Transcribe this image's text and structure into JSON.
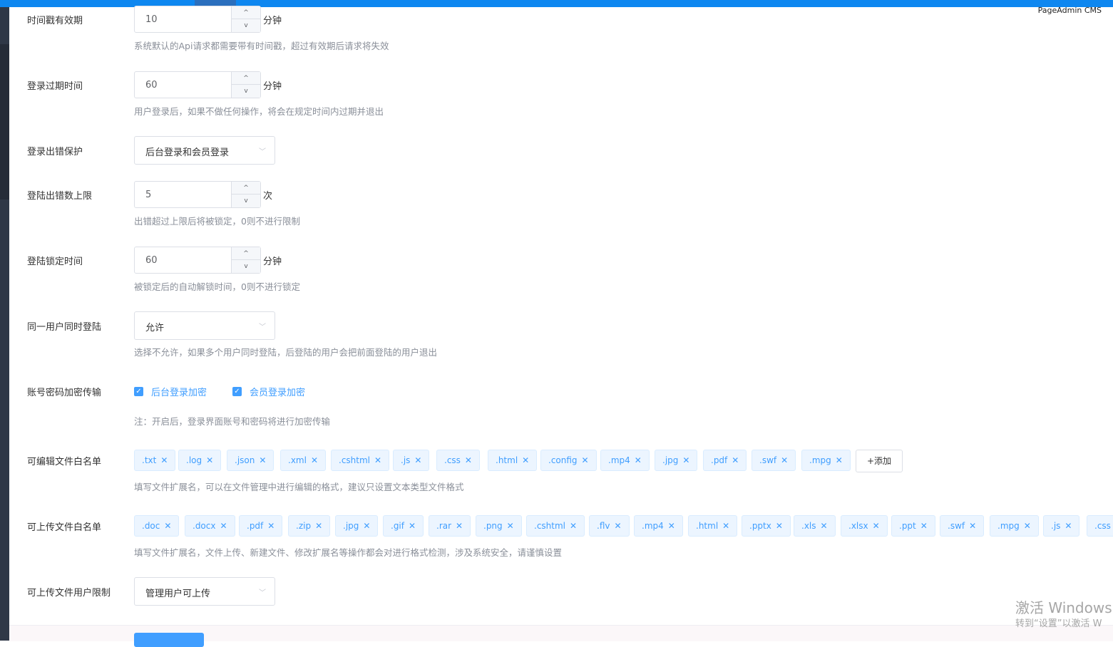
{
  "brand": "PageAdmin CMS",
  "watermark": {
    "line1": "激活 Windows",
    "line2": "转到“设置”以激活 W"
  },
  "fields": {
    "timestamp": {
      "label": "时间戳有效期",
      "value": "10",
      "unit": "分钟",
      "hint": "系统默认的Api请求都需要带有时间戳，超过有效期后请求将失效"
    },
    "login_expire": {
      "label": "登录过期时间",
      "value": "60",
      "unit": "分钟",
      "hint": "用户登录后，如果不做任何操作，将会在规定时间内过期并退出"
    },
    "login_protect": {
      "label": "登录出错保护",
      "selected": "后台登录和会员登录"
    },
    "error_limit": {
      "label": "登陆出错数上限",
      "value": "5",
      "unit": "次",
      "hint": "出错超过上限后将被锁定，0则不进行限制"
    },
    "lock_time": {
      "label": "登陆锁定时间",
      "value": "60",
      "unit": "分钟",
      "hint": "被锁定后的自动解锁时间，0则不进行锁定"
    },
    "same_user": {
      "label": "同一用户同时登陆",
      "selected": "允许",
      "hint": "选择不允许，如果多个用户同时登陆，后登陆的用户会把前面登陆的用户退出"
    },
    "encrypt": {
      "label": "账号密码加密传输",
      "opt1": "后台登录加密",
      "opt2": "会员登录加密",
      "hint": "注：开启后，登录界面账号和密码将进行加密传输"
    },
    "edit_whitelist": {
      "label": "可编辑文件白名单",
      "tags": [
        ".txt",
        ".log",
        ".json",
        ".xml",
        ".cshtml",
        ".js",
        ".css",
        ".html",
        ".config",
        ".mp4",
        ".jpg",
        ".pdf",
        ".swf",
        ".mpg"
      ],
      "add_label": "+添加",
      "hint": "填写文件扩展名，可以在文件管理中进行编辑的格式，建议只设置文本类型文件格式"
    },
    "upload_whitelist": {
      "label": "可上传文件白名单",
      "tags": [
        ".doc",
        ".docx",
        ".pdf",
        ".zip",
        ".jpg",
        ".gif",
        ".rar",
        ".png",
        ".cshtml",
        ".flv",
        ".mp4",
        ".html",
        ".pptx",
        ".xls",
        ".xlsx",
        ".ppt",
        ".swf",
        ".mpg",
        ".js",
        ".css"
      ],
      "hint": "填写文件扩展名，文件上传、新建文件、修改扩展名等操作都会对进行格式检测，涉及系统安全，请谨慎设置"
    },
    "upload_user": {
      "label": "可上传文件用户限制",
      "selected": "管理用户可上传"
    }
  },
  "icons": {
    "up": "^",
    "down": "v",
    "chevron": "﹀",
    "check": "✓",
    "close": "✕"
  }
}
